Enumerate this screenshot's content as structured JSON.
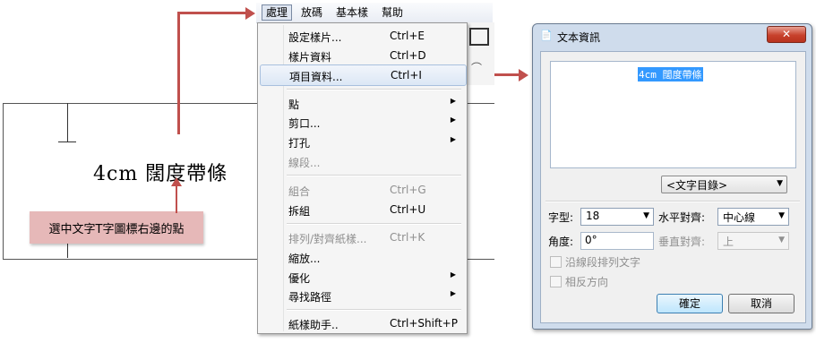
{
  "canvas": {
    "text": "4cm 闊度帶條",
    "callout": "選中文字T字圖標右邊的點"
  },
  "menubar": {
    "items": [
      "處理",
      "放碼",
      "基本樣",
      "幫助"
    ]
  },
  "menu": {
    "items": [
      {
        "label": "設定樣片...",
        "shortcut": "Ctrl+E"
      },
      {
        "label": "樣片資料",
        "shortcut": "Ctrl+D"
      },
      {
        "label": "項目資料...",
        "shortcut": "Ctrl+I"
      },
      {
        "label": "點",
        "shortcut": ""
      },
      {
        "label": "剪口...",
        "shortcut": ""
      },
      {
        "label": "打孔",
        "shortcut": ""
      },
      {
        "label": "線段...",
        "shortcut": ""
      },
      {
        "label": "組合",
        "shortcut": "Ctrl+G"
      },
      {
        "label": "拆組",
        "shortcut": "Ctrl+U"
      },
      {
        "label": "排列/對齊紙樣...",
        "shortcut": "Ctrl+K"
      },
      {
        "label": "縮放...",
        "shortcut": ""
      },
      {
        "label": "優化",
        "shortcut": ""
      },
      {
        "label": "尋找路徑",
        "shortcut": ""
      },
      {
        "label": "紙樣助手..",
        "shortcut": "Ctrl+Shift+P"
      }
    ]
  },
  "dialog": {
    "title": "文本資訊",
    "close_glyph": "✕",
    "text_content": "4cm 闊度帶條",
    "text_directory": "<文字目錄>",
    "font_label": "字型:",
    "font_value": "18",
    "halign_label": "水平對齊:",
    "halign_value": "中心線",
    "angle_label": "角度:",
    "angle_value": "0°",
    "valign_label": "垂直對齊:",
    "valign_value": "上",
    "follow_line_label": "沿線段排列文字",
    "reverse_label": "相反方向",
    "ok_label": "確定",
    "cancel_label": "取消"
  },
  "icons": {
    "submenu_arrow": "▶",
    "dropdown_arrow": "▼"
  },
  "colors": {
    "arrow": "#c0504d",
    "callout_bg": "#e6b8b8",
    "selection": "#3399ff"
  }
}
